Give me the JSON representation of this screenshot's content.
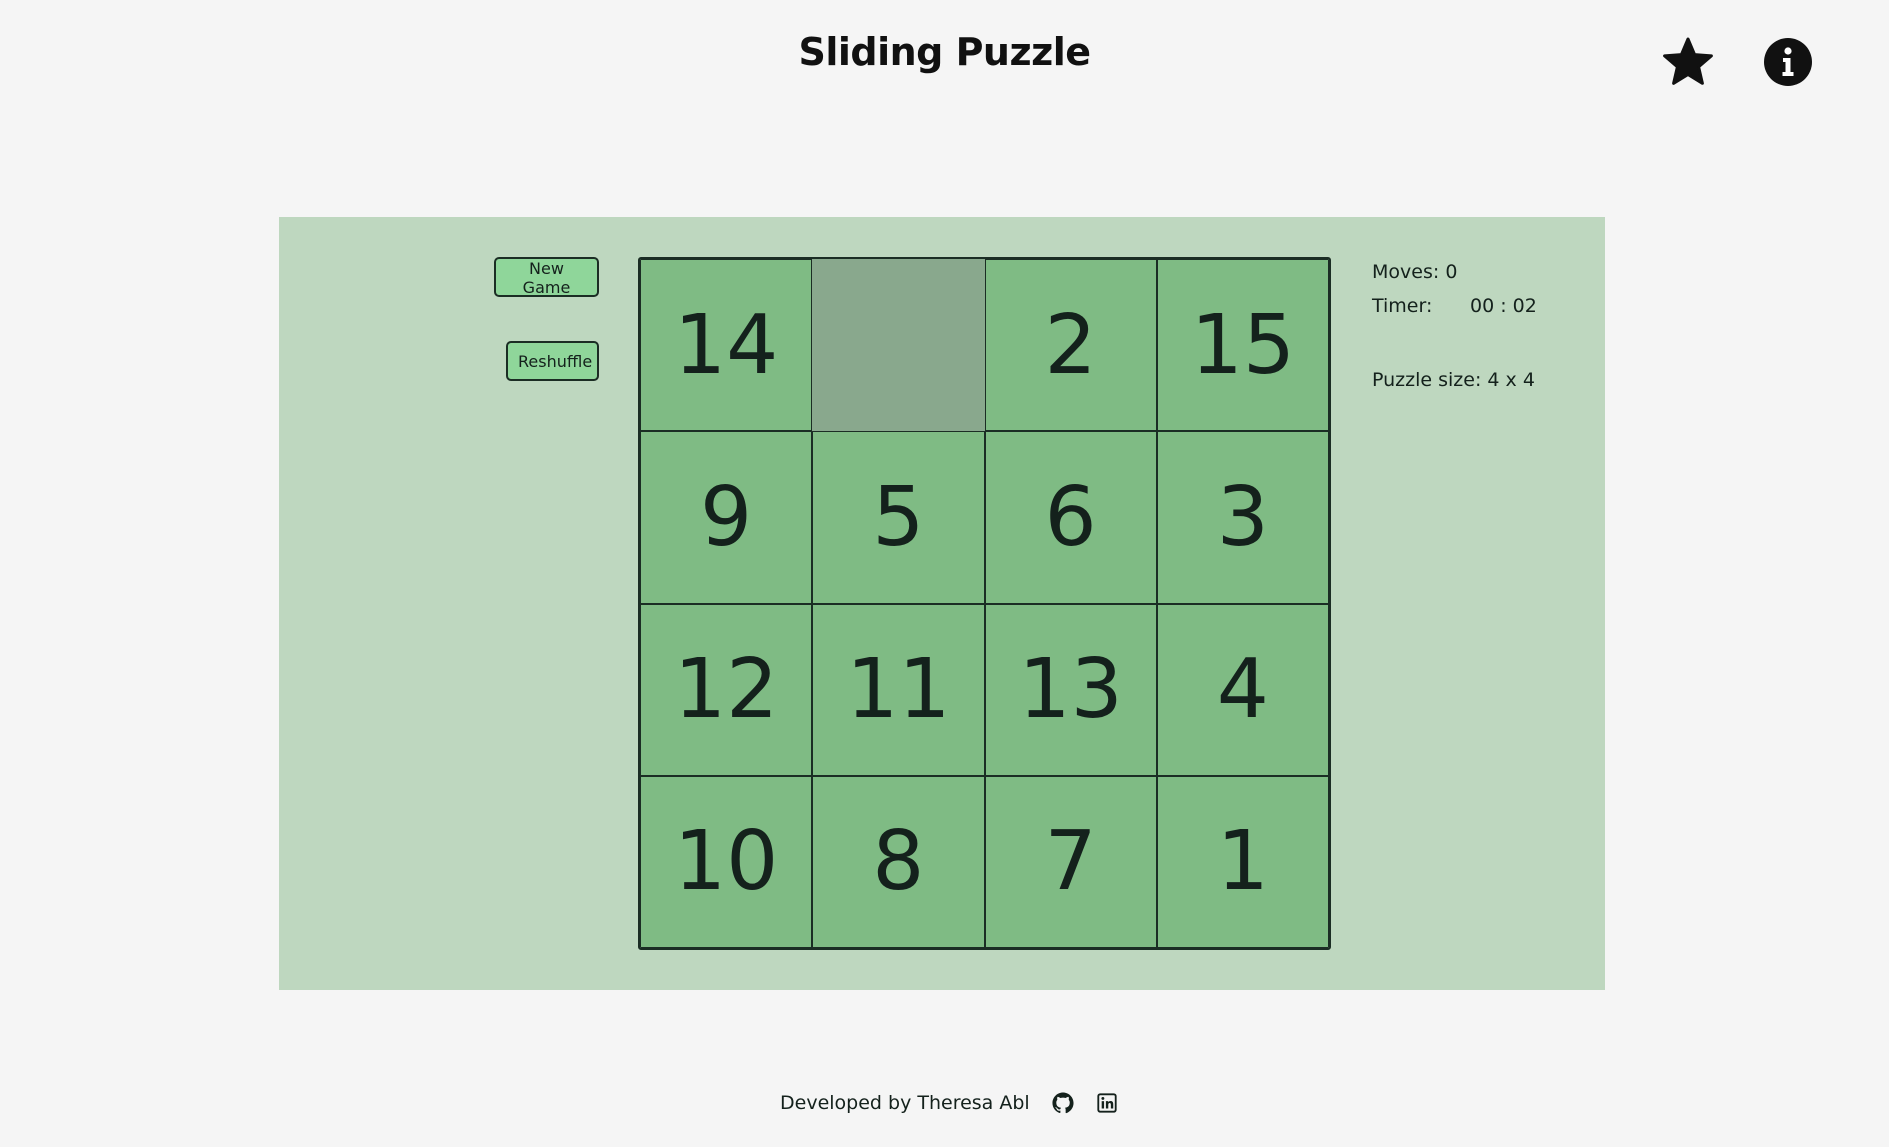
{
  "header": {
    "title": "Sliding Puzzle",
    "icons": [
      "star-icon",
      "info-icon"
    ]
  },
  "controls": {
    "new_game_label": "New Game",
    "reshuffle_label": "Reshuffle"
  },
  "board": {
    "rows": 4,
    "cols": 4,
    "tiles": [
      14,
      null,
      2,
      15,
      9,
      5,
      6,
      3,
      12,
      11,
      13,
      4,
      10,
      8,
      7,
      1
    ]
  },
  "stats": {
    "moves_label": "Moves:",
    "moves_value": "0",
    "timer_label": "Timer:",
    "timer_value": "00 : 02",
    "puzzle_size_label": "Puzzle size:",
    "puzzle_size_value": "4 x 4"
  },
  "footer": {
    "credit": "Developed by Theresa Abl",
    "icons": [
      "github-icon",
      "linkedin-icon"
    ]
  },
  "colors": {
    "page_background": "#f5f5f5",
    "panel_background": "#bed7bf",
    "tile": "#7fbb84",
    "empty_tile": "#89a88d",
    "button": "#8fd69a",
    "text": "#14211c"
  }
}
